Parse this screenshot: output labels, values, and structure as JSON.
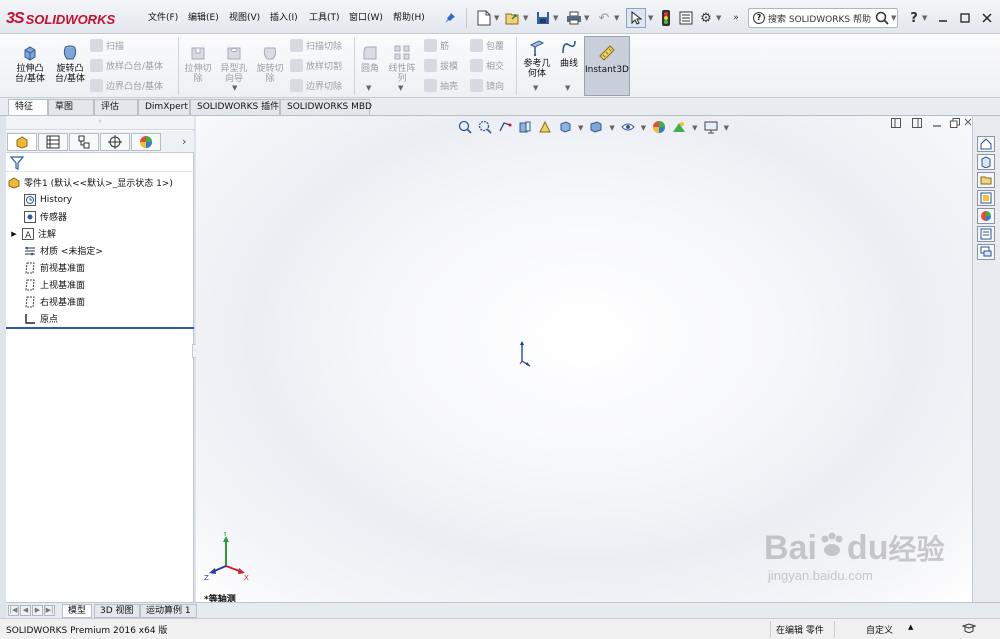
{
  "app": {
    "logo_ds": "3S",
    "logo_text": "SOLIDWORKS"
  },
  "menu": [
    {
      "label": "文件(F)"
    },
    {
      "label": "编辑(E)"
    },
    {
      "label": "视图(V)"
    },
    {
      "label": "插入(I)"
    },
    {
      "label": "工具(T)"
    },
    {
      "label": "窗口(W)"
    },
    {
      "label": "帮助(H)"
    }
  ],
  "search": {
    "placeholder": "搜索 SOLIDWORKS 帮助"
  },
  "ribbon": {
    "extrude_boss": "拉伸凸\n台/基体",
    "revolve_boss": "旋转凸\n台/基体",
    "sweep": "扫描",
    "loft_boss": "放样凸台/基体",
    "boundary_boss": "边界凸台/基体",
    "extrude_cut": "拉伸切\n除",
    "hole_wizard": "异型孔\n向导",
    "revolve_cut": "旋转切\n除",
    "swept_cut": "扫描切除",
    "lofted_cut": "放样切割",
    "boundary_cut": "边界切除",
    "fillet": "圆角",
    "linear_pattern": "线性阵\n列",
    "rib": "筋",
    "draft": "拔模",
    "shell": "抽壳",
    "wrap": "包覆",
    "intersect": "相交",
    "mirror": "镜向",
    "reference_geometry": "参考几\n何体",
    "curves": "曲线",
    "instant3d": "Instant3D"
  },
  "tabs": [
    {
      "label": "特征",
      "active": true
    },
    {
      "label": "草图"
    },
    {
      "label": "评估"
    },
    {
      "label": "DimXpert"
    },
    {
      "label": "SOLIDWORKS 插件"
    },
    {
      "label": "SOLIDWORKS MBD"
    }
  ],
  "feature_tree": {
    "root": "零件1 (默认<<默认>_显示状态 1>)",
    "items": [
      {
        "label": "History",
        "icon": "history-icon"
      },
      {
        "label": "传感器",
        "icon": "sensor-icon"
      },
      {
        "label": "注解",
        "icon": "annotation-icon",
        "expandable": true
      },
      {
        "label": "材质 <未指定>",
        "icon": "material-icon"
      },
      {
        "label": "前视基准面",
        "icon": "plane-icon"
      },
      {
        "label": "上视基准面",
        "icon": "plane-icon"
      },
      {
        "label": "右视基准面",
        "icon": "plane-icon"
      },
      {
        "label": "原点",
        "icon": "origin-icon"
      }
    ]
  },
  "viewport": {
    "view_name": "*等轴测",
    "triad": {
      "x": "X",
      "y": "Y",
      "z": "Z"
    }
  },
  "bottom_tabs": [
    {
      "label": "模型",
      "active": true
    },
    {
      "label": "3D 视图"
    },
    {
      "label": "运动算例 1"
    }
  ],
  "status": {
    "product": "SOLIDWORKS Premium 2016 x64 版",
    "mode": "在编辑 零件",
    "units": "自定义"
  },
  "watermark": {
    "brand": "Bai",
    "brand2": "du",
    "brand3": "经验",
    "url": "jingyan.baidu.com"
  },
  "colors": {
    "brand_red": "#c8102e",
    "tree_selection": "#2a5caa"
  }
}
